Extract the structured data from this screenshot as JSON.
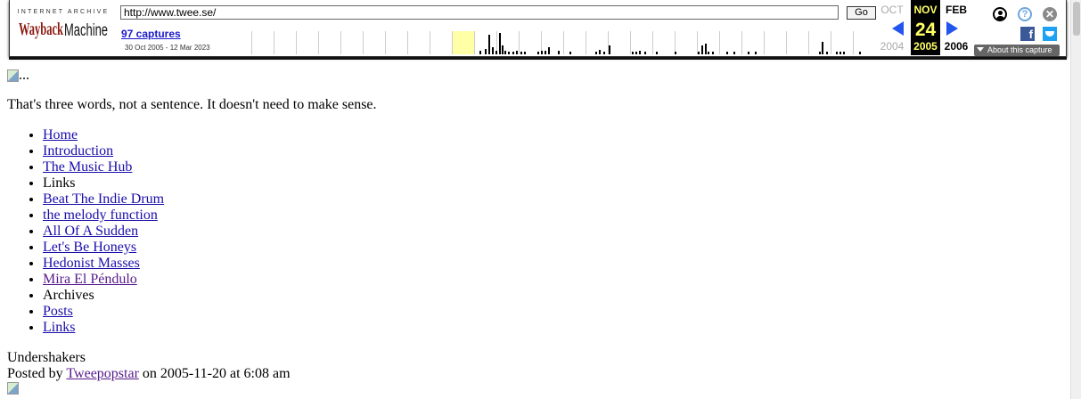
{
  "toolbar": {
    "logo": {
      "ia_text": "INTERNET ARCHIVE",
      "wayback_text": "WaybackMachine"
    },
    "url": "http://www.twee.se/",
    "go_label": "Go",
    "captures_label": "97 captures",
    "range_label": "30 Oct 2005 - 12 Mar 2023",
    "prev_month": "OCT",
    "prev_year": "2004",
    "cur_month": "NOV",
    "cur_day": "24",
    "cur_year": "2005",
    "next_month": "FEB",
    "next_year": "2006",
    "about_label": "About this capture",
    "icons": [
      "user-icon",
      "help-icon",
      "close-icon",
      "facebook-icon",
      "twitter-icon"
    ],
    "accent": "#2255ee",
    "highlight": "#ffffa5"
  },
  "page": {
    "header_img_alt": "...",
    "tagline": "That's three words, not a sentence. It doesn't need to make sense.",
    "nav": [
      {
        "label": "Home",
        "link": true
      },
      {
        "label": "Introduction",
        "link": true
      },
      {
        "label": "The Music Hub",
        "link": true
      },
      {
        "label": "Links",
        "link": false
      },
      {
        "label": "Beat The Indie Drum",
        "link": true
      },
      {
        "label": "the melody function",
        "link": true
      },
      {
        "label": "All Of A Sudden",
        "link": true
      },
      {
        "label": "Let's Be Honeys",
        "link": true
      },
      {
        "label": "Hedonist Masses",
        "link": true
      },
      {
        "label": "Mira El Péndulo",
        "link": true,
        "visited": true
      },
      {
        "label": "Archives",
        "link": false
      },
      {
        "label": "Posts",
        "link": true
      },
      {
        "label": "Links",
        "link": true
      }
    ],
    "post": {
      "title": "Undershakers",
      "posted_by_prefix": "Posted by ",
      "author": "Tweepopstar",
      "posted_on": " on 2005-11-20 at 6:08 am"
    }
  }
}
